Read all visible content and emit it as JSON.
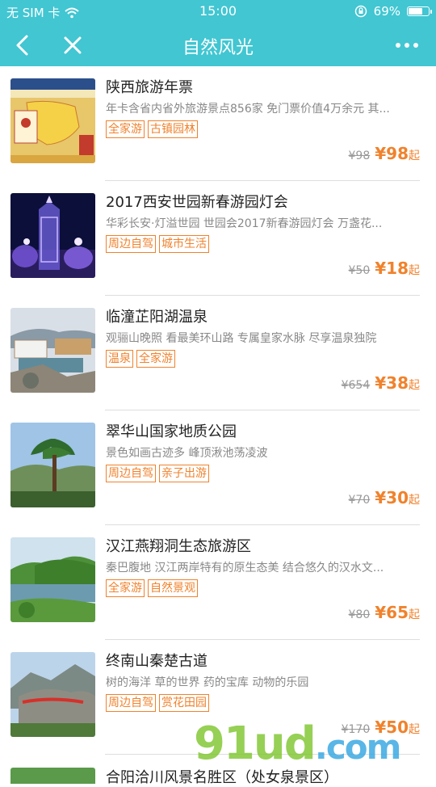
{
  "status": {
    "carrier": "无 SIM 卡",
    "time": "15:00",
    "battery": "69%",
    "battery_level": 0.69
  },
  "nav": {
    "title": "自然风光"
  },
  "items": [
    {
      "title": "陕西旅游年票",
      "desc": "年卡含省内省外旅游景点856家 免门票价值4万余元 其...",
      "tags": [
        "全家游",
        "古镇园林"
      ],
      "orig_price": "¥98",
      "price": "¥98",
      "price_suffix": "起"
    },
    {
      "title": "2017西安世园新春游园灯会",
      "desc": "华彩长安·灯溢世园 世园会2017新春游园灯会 万盏花...",
      "tags": [
        "周边自驾",
        "城市生活"
      ],
      "orig_price": "¥50",
      "price": "¥18",
      "price_suffix": "起"
    },
    {
      "title": "临潼芷阳湖温泉",
      "desc": "观骊山晚照 看最美环山路 专属皇家水脉 尽享温泉独院",
      "tags": [
        "温泉",
        "全家游"
      ],
      "orig_price": "¥654",
      "price": "¥38",
      "price_suffix": "起"
    },
    {
      "title": "翠华山国家地质公园",
      "desc": "景色如画古迹多 峰顶湫池荡凌波",
      "tags": [
        "周边自驾",
        "亲子出游"
      ],
      "orig_price": "¥70",
      "price": "¥30",
      "price_suffix": "起"
    },
    {
      "title": "汉江燕翔洞生态旅游区",
      "desc": "秦巴腹地 汉江两岸特有的原生态美 结合悠久的汉水文...",
      "tags": [
        "全家游",
        "自然景观"
      ],
      "orig_price": "¥80",
      "price": "¥65",
      "price_suffix": "起"
    },
    {
      "title": "终南山秦楚古道",
      "desc": "树的海洋 草的世界 药的宝库 动物的乐园",
      "tags": [
        "周边自驾",
        "赏花田园"
      ],
      "orig_price": "¥170",
      "price": "¥50",
      "price_suffix": "起"
    }
  ],
  "partial_item": {
    "title": "合阳洽川风景名胜区（处女泉景区）"
  },
  "watermark": {
    "main": "91ud",
    "suffix": ".com"
  },
  "colors": {
    "header": "#41c6d2",
    "accent": "#f0822c"
  }
}
